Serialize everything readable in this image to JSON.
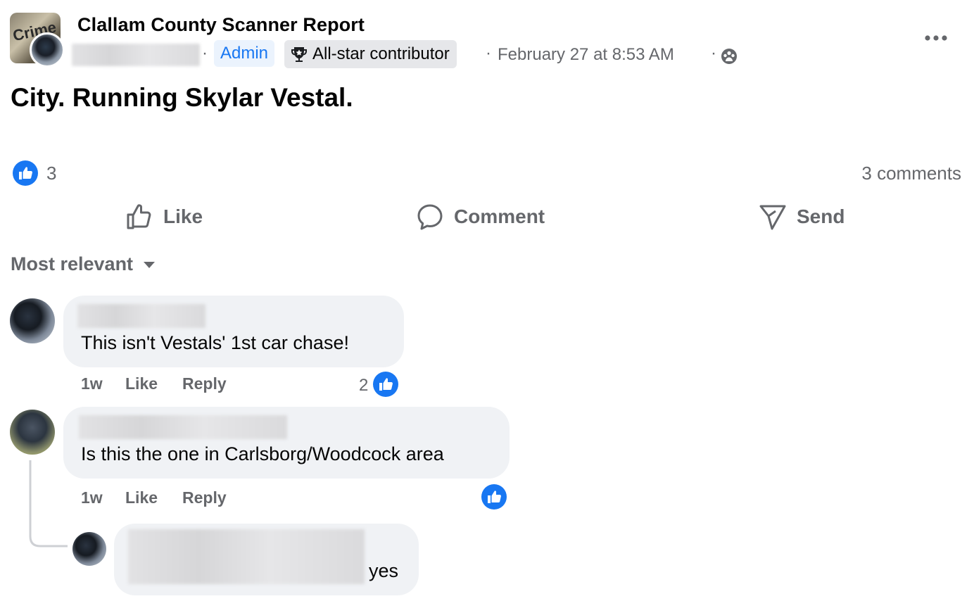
{
  "post": {
    "group_name": "Clallam County Scanner Report",
    "avatar_text": "Crime",
    "badge_admin": "Admin",
    "badge_contributor": "All-star contributor",
    "separator": "·",
    "timestamp": "February 27 at 8:53 AM",
    "text": "City. Running Skylar Vestal.",
    "like_count": "3",
    "comment_count": "3 comments"
  },
  "actions": {
    "like": "Like",
    "comment": "Comment",
    "send": "Send"
  },
  "sort": {
    "label": "Most relevant"
  },
  "comments": [
    {
      "text": "This isn't Vestals' 1st car chase!",
      "time": "1w",
      "like": "Like",
      "reply": "Reply",
      "reactions": "2"
    },
    {
      "text": "Is this the one in Carlsborg/Woodcock area",
      "time": "1w",
      "like": "Like",
      "reply": "Reply",
      "reactions": ""
    },
    {
      "text": "yes"
    }
  ],
  "colors": {
    "accent": "#1877f2",
    "muted": "#65676b",
    "bubble": "#f0f2f5"
  },
  "icons": [
    "like-icon",
    "comment-icon",
    "send-icon",
    "more-icon",
    "privacy-icon",
    "trophy-icon",
    "caret-down-icon"
  ]
}
